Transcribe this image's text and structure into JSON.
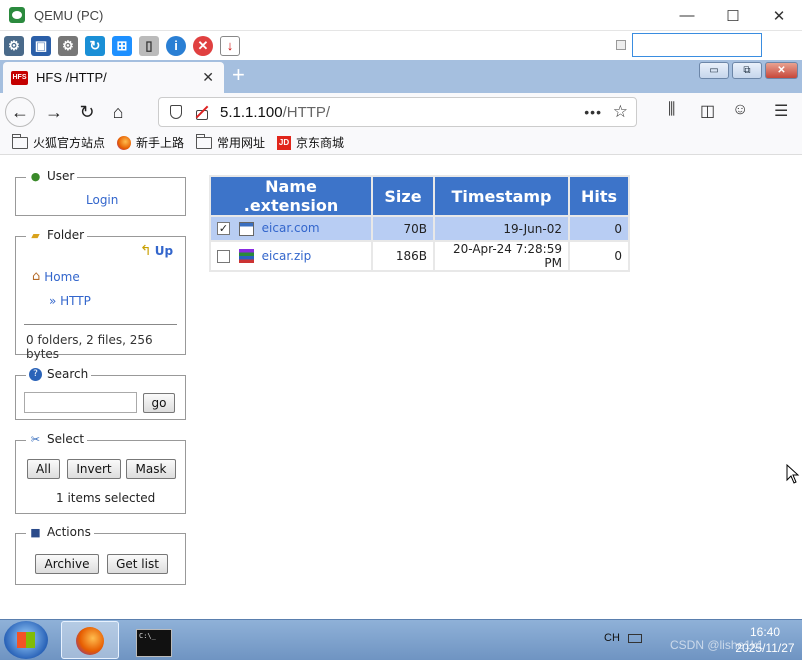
{
  "qemu": {
    "title": "QEMU (PC)",
    "min": "—",
    "max": "☐",
    "close": "✕"
  },
  "browser": {
    "tab_title": "HFS /HTTP/",
    "url_host": "5.1.1.100",
    "url_path": "/HTTP/",
    "bookmarks": [
      "火狐官方站点",
      "新手上路",
      "常用网址",
      "京东商城"
    ]
  },
  "sidebar": {
    "user": {
      "legend": "User",
      "login": "Login"
    },
    "folder": {
      "legend": "Folder",
      "up": "Up",
      "home": "Home",
      "current": "» HTTP",
      "summary": "0 folders, 2 files, 256 bytes"
    },
    "search": {
      "legend": "Search",
      "value": "",
      "go": "go"
    },
    "select": {
      "legend": "Select",
      "all": "All",
      "invert": "Invert",
      "mask": "Mask",
      "status": "1 items selected"
    },
    "actions": {
      "legend": "Actions",
      "archive": "Archive",
      "get_list": "Get list"
    }
  },
  "files": {
    "headers": [
      "Name .extension",
      "Size",
      "Timestamp",
      "Hits"
    ],
    "rows": [
      {
        "name": "eicar.com",
        "size": "70B",
        "timestamp": "19-Jun-02",
        "hits": "0",
        "checked": true,
        "check_mark": "✓"
      },
      {
        "name": "eicar.zip",
        "size": "186B",
        "timestamp": "20-Apr-24 7:28:59 PM",
        "hits": "0",
        "checked": false,
        "check_mark": ""
      }
    ]
  },
  "taskbar": {
    "ime": "CH",
    "time": "16:40",
    "date": "2025/11/27",
    "watermark": "CSDN @lishe1k1"
  }
}
